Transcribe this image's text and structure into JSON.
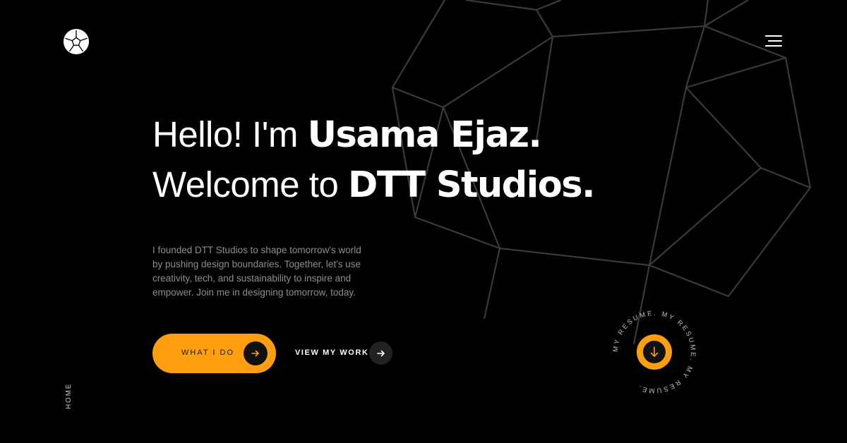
{
  "colors": {
    "background": "#000000",
    "accent": "#ff9f0f",
    "wireframe": "#3a3a3a",
    "body_text": "#8d8d8d"
  },
  "logo": {
    "icon": "dodecahedron-logo-icon"
  },
  "menu": {
    "icon": "hamburger-menu-icon"
  },
  "hero": {
    "line1_light": "Hello! I'm ",
    "line1_bold": "Usama Ejaz.",
    "line2_light": "Welcome to ",
    "line2_bold": "DTT Studios."
  },
  "intro": {
    "text": "I founded DTT Studios to shape tomorrow's world by pushing design boundaries. Together, let's use creativity, tech, and sustainability to inspire and empower. Join me in designing tomorrow, today."
  },
  "buttons": {
    "primary_label": "WHAT I DO",
    "primary_icon": "arrow-right-icon",
    "secondary_label": "VIEW MY WORK",
    "secondary_icon": "arrow-right-icon"
  },
  "resume": {
    "circular_text": "MY RESUME. MY RESUME. MY RESUME.",
    "icon": "arrow-down-icon"
  },
  "side_nav": {
    "label": "HOME"
  }
}
